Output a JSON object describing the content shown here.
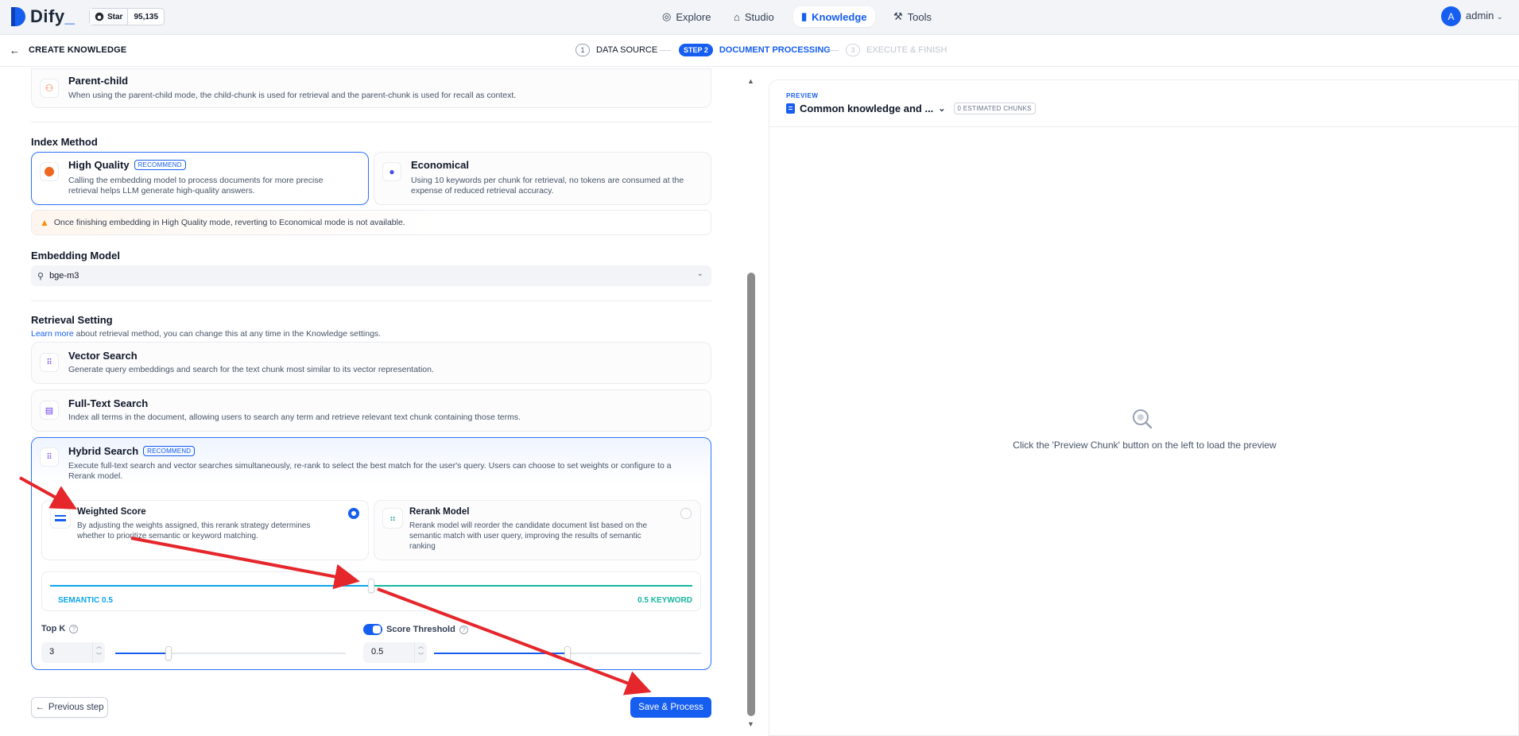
{
  "app": {
    "logo_text": "Dify",
    "github_star_label": "Star",
    "github_star_count": "95,135",
    "nav": [
      "Explore",
      "Studio",
      "Knowledge",
      "Tools"
    ],
    "active_nav": "Knowledge",
    "user_initial": "A",
    "user_name": "admin"
  },
  "stepbar": {
    "back_title": "CREATE KNOWLEDGE",
    "steps": [
      {
        "num": "1",
        "label": "DATA SOURCE"
      },
      {
        "num": "STEP 2",
        "label": "DOCUMENT PROCESSING"
      },
      {
        "num": "3",
        "label": "EXECUTE & FINISH"
      }
    ]
  },
  "chunk_mode": {
    "title": "Parent-child",
    "desc": "When using the parent-child mode, the child-chunk is used for retrieval and the parent-chunk is used for recall as context."
  },
  "index_method": {
    "title": "Index Method",
    "high_quality": {
      "title": "High Quality",
      "badge": "RECOMMEND",
      "desc1": "Calling the embedding model to process documents for more precise",
      "desc2": "retrieval helps LLM generate high-quality answers."
    },
    "economical": {
      "title": "Economical",
      "desc1": "Using 10 keywords per chunk for retrieval, no tokens are consumed at the",
      "desc2": "expense of reduced retrieval accuracy."
    },
    "warning": "Once finishing embedding in High Quality mode, reverting to Economical mode is not available."
  },
  "embedding": {
    "title": "Embedding Model",
    "model": "bge-m3"
  },
  "retrieval": {
    "title": "Retrieval Setting",
    "learn_more": "Learn more",
    "learn_more_rest": " about retrieval method, you can change this at any time in the Knowledge settings.",
    "vector": {
      "title": "Vector Search",
      "desc": "Generate query embeddings and search for the text chunk most similar to its vector representation."
    },
    "fulltext": {
      "title": "Full-Text Search",
      "desc": "Index all terms in the document, allowing users to search any term and retrieve relevant text chunk containing those terms."
    },
    "hybrid": {
      "title": "Hybrid Search",
      "badge": "RECOMMEND",
      "desc1": "Execute full-text search and vector searches simultaneously, re-rank to select the best match for the user's query. Users can choose to set weights or configure to a",
      "desc2": "Rerank model."
    },
    "weighted": {
      "title": "Weighted Score",
      "desc1": "By adjusting the weights assigned, this rerank strategy determines",
      "desc2": "whether to prioritize semantic or keyword matching."
    },
    "rerank": {
      "title": "Rerank Model",
      "desc1": "Rerank model will reorder the candidate document list based on the",
      "desc2": "semantic match with user query, improving the results of semantic",
      "desc3": "ranking"
    },
    "semantic_label": "SEMANTIC 0.5",
    "keyword_label": "0.5 KEYWORD",
    "semantic_weight": 0.5,
    "top_k_label": "Top K",
    "top_k_value": "3",
    "top_k_level": 0.23,
    "score_label": "Score Threshold",
    "score_value": "0.5",
    "score_level": 0.5
  },
  "buttons": {
    "previous": "Previous step",
    "save": "Save & Process"
  },
  "preview": {
    "label": "PREVIEW",
    "doc_name": "Common knowledge and ...",
    "chunks": "0 ESTIMATED CHUNKS",
    "empty_text": "Click the 'Preview Chunk' button on the left to load the preview"
  },
  "colors": {
    "accent": "#155eef",
    "semantic": "#0ba5ec",
    "keyword": "#15b79e",
    "annotation_arrow": "#e5262b"
  }
}
